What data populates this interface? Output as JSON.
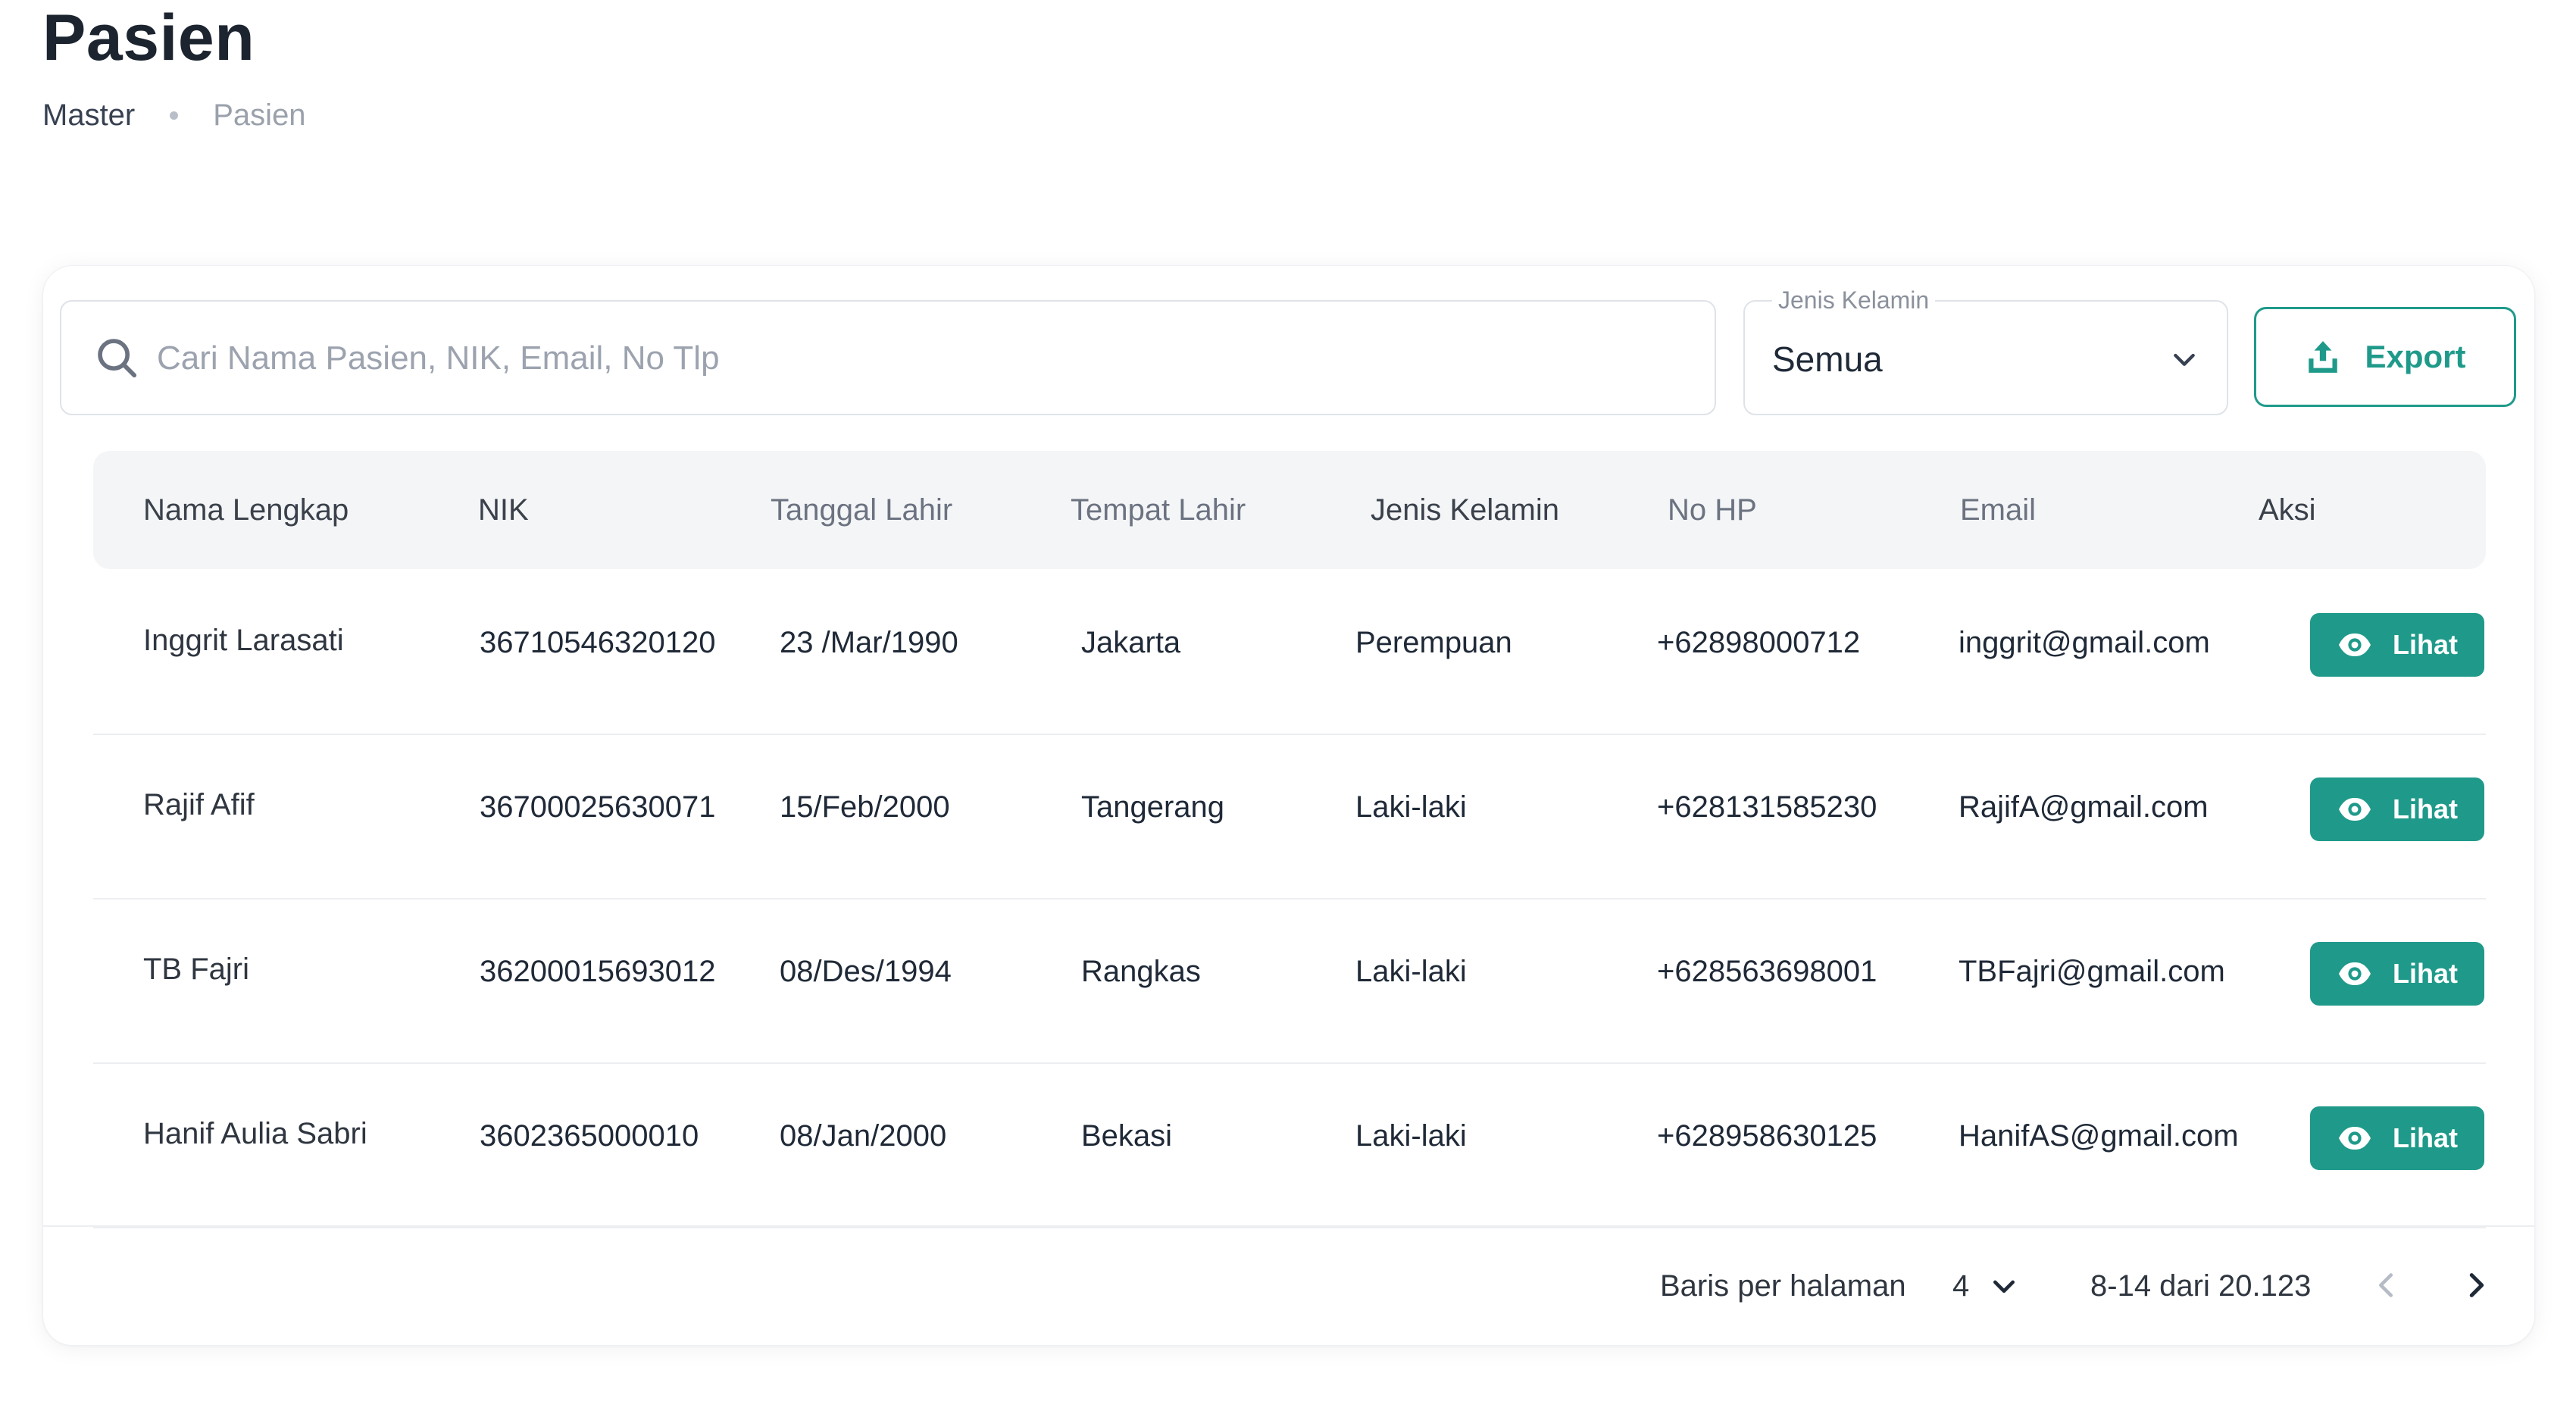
{
  "page": {
    "title": "Pasien",
    "breadcrumb": [
      "Master",
      "Pasien"
    ]
  },
  "colors": {
    "accent": "#1f9a8a",
    "header_bg": "#f4f5f7"
  },
  "search": {
    "placeholder": "Cari Nama Pasien, NIK, Email, No Tlp",
    "value": "",
    "icon": "search-icon"
  },
  "filter": {
    "label": "Jenis Kelamin",
    "value": "Semua",
    "icon": "chevron-down-icon"
  },
  "export": {
    "label": "Export",
    "icon": "upload-icon"
  },
  "table": {
    "columns": [
      "Nama Lengkap",
      "NIK",
      "Tanggal Lahir",
      "Tempat Lahir",
      "Jenis Kelamin",
      "No HP",
      "Email",
      "Aksi"
    ],
    "rows": [
      {
        "name": "Inggrit Larasati",
        "nik": "36710546320120",
        "dob": "23 /Mar/1990",
        "pob": "Jakarta",
        "gender": "Perempuan",
        "phone": "+62898000712",
        "email": "inggrit@gmail.com",
        "action": "Lihat"
      },
      {
        "name": "Rajif Afif",
        "nik": "36700025630071",
        "dob": "15/Feb/2000",
        "pob": "Tangerang",
        "gender": "Laki-laki",
        "phone": "+628131585230",
        "email": "RajifA@gmail.com",
        "action": "Lihat"
      },
      {
        "name": "TB Fajri",
        "nik": "36200015693012",
        "dob": "08/Des/1994",
        "pob": "Rangkas",
        "gender": "Laki-laki",
        "phone": "+628563698001",
        "email": "TBFajri@gmail.com",
        "action": "Lihat"
      },
      {
        "name": "Hanif Aulia Sabri",
        "nik": "3602365000010",
        "dob": "08/Jan/2000",
        "pob": "Bekasi",
        "gender": "Laki-laki",
        "phone": "+628958630125",
        "email": "HanifAS@gmail.com",
        "action": "Lihat"
      }
    ],
    "action_icon": "eye-icon"
  },
  "pagination": {
    "rows_label": "Baris per halaman",
    "rows_per_page": "4",
    "range": "8-14 dari 20.123"
  }
}
